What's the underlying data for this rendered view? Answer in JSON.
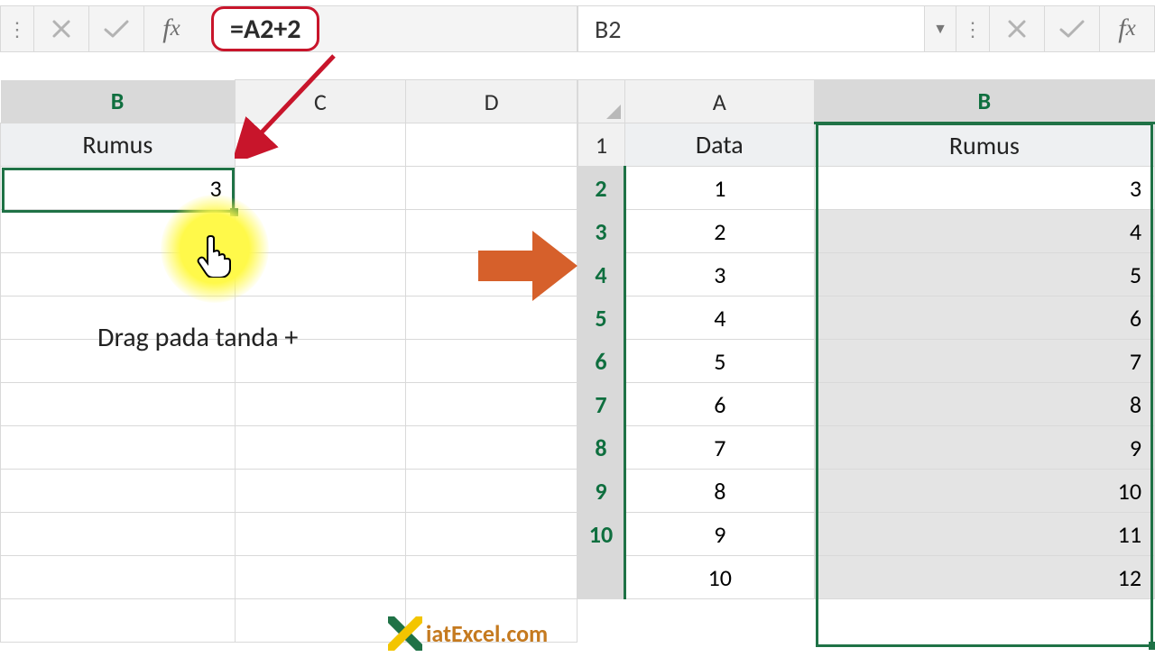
{
  "left": {
    "formula": "=A2+2",
    "columns": [
      "B",
      "C",
      "D"
    ],
    "header_label": "Rumus",
    "active_value": "3",
    "drag_hint": "Drag pada tanda +"
  },
  "right": {
    "namebox": "B2",
    "columns": [
      "A",
      "B"
    ],
    "col_headers": {
      "A": "Data",
      "B": "Rumus"
    },
    "rows": [
      {
        "n": "1"
      },
      {
        "n": "2",
        "A": "1",
        "B": "3"
      },
      {
        "n": "3",
        "A": "2",
        "B": "4"
      },
      {
        "n": "4",
        "A": "3",
        "B": "5"
      },
      {
        "n": "5",
        "A": "4",
        "B": "6"
      },
      {
        "n": "6",
        "A": "5",
        "B": "7"
      },
      {
        "n": "7",
        "A": "6",
        "B": "8"
      },
      {
        "n": "8",
        "A": "7",
        "B": "9"
      },
      {
        "n": "9",
        "A": "8",
        "B": "10"
      },
      {
        "n": "10",
        "A": "9",
        "B": "11"
      },
      {
        "n": "",
        "A": "10",
        "B": "12"
      }
    ]
  },
  "watermark": "iatExcel.com",
  "icons": {
    "dots": "⋮",
    "dropdown": "▼"
  }
}
